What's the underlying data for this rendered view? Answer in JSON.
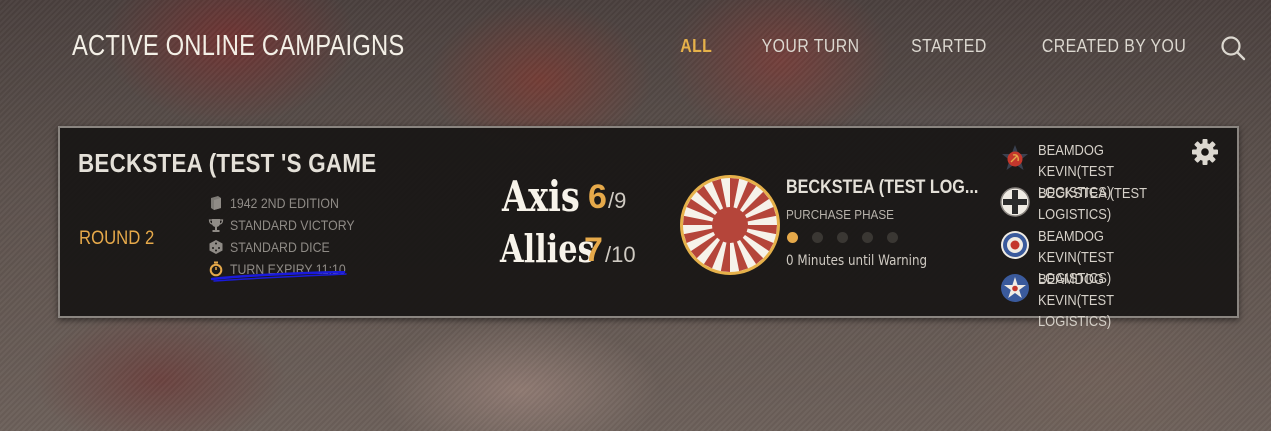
{
  "header": {
    "title": "ACTIVE ONLINE CAMPAIGNS",
    "filters": [
      {
        "label": "ALL",
        "active": true
      },
      {
        "label": "YOUR TURN",
        "active": false
      },
      {
        "label": "STARTED",
        "active": false
      },
      {
        "label": "CREATED BY YOU",
        "active": false
      }
    ],
    "search_icon": "search-icon"
  },
  "colors": {
    "accent": "#e6a94a",
    "card_bg": "#181614",
    "text_light": "#e4e0d8",
    "text_muted": "#8f8b86",
    "annotation_line": "#1a1adb"
  },
  "campaign": {
    "title": "BECKSTEA (TEST 'S GAME",
    "round": "ROUND 2",
    "settings": [
      {
        "icon": "book-icon",
        "label": "1942 2ND EDITION"
      },
      {
        "icon": "trophy-icon",
        "label": "STANDARD VICTORY"
      },
      {
        "icon": "dice-icon",
        "label": "STANDARD DICE"
      },
      {
        "icon": "timer-icon",
        "label": "TURN EXPIRY 11:10"
      }
    ],
    "scores": {
      "axis": {
        "label": "Axis",
        "value": "6",
        "total": "/9"
      },
      "allies": {
        "label": "Allies",
        "value": "7",
        "total": "/10"
      }
    },
    "current_player": {
      "flag_icon": "japan-rising-sun-icon",
      "name": "BECKSTEA (TEST LOG...",
      "phase": "PURCHASE PHASE",
      "phase_progress": {
        "current": 1,
        "total": 5
      },
      "warning": "0 Minutes until Warning"
    },
    "players": [
      {
        "icon": "soviet-star-icon",
        "name": "BEAMDOG KEVIN(TEST LOGISTICS)"
      },
      {
        "icon": "german-cross-icon",
        "name": "BECKSTEA (TEST LOGISTICS)"
      },
      {
        "icon": "uk-roundel-icon",
        "name": "BEAMDOG KEVIN(TEST LOGISTICS)"
      },
      {
        "icon": "us-star-roundel-icon",
        "name": "BEAMDOG KEVIN(TEST LOGISTICS)"
      }
    ],
    "settings_icon": "gear-icon"
  }
}
